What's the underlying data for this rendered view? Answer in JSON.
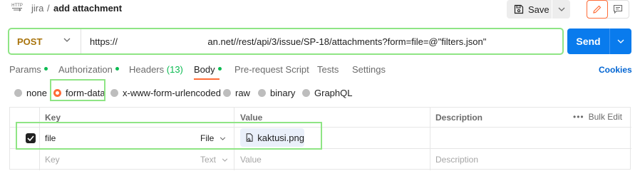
{
  "header": {
    "request_icon_text": "HTTP",
    "breadcrumb_parent": "jira",
    "breadcrumb_separator": "/",
    "breadcrumb_current": "add attachment",
    "save_label": "Save"
  },
  "request": {
    "method": "POST",
    "url": "https://                                   an.net//rest/api/3/issue/SP-18/attachments?form=file=@\"filters.json\"",
    "send_label": "Send"
  },
  "tabs": [
    {
      "label": "Params",
      "dot": true
    },
    {
      "label": "Authorization",
      "dot": true
    },
    {
      "label": "Headers",
      "count": "(13)"
    },
    {
      "label": "Body",
      "dot": true,
      "active": true
    },
    {
      "label": "Pre-request Script"
    },
    {
      "label": "Tests"
    },
    {
      "label": "Settings"
    }
  ],
  "cookies_label": "Cookies",
  "body_types": [
    "none",
    "form-data",
    "x-www-form-urlencoded",
    "raw",
    "binary",
    "GraphQL"
  ],
  "body_type_selected": "form-data",
  "table": {
    "headers": {
      "key": "Key",
      "value": "Value",
      "description": "Description",
      "bulk_edit": "Bulk Edit"
    },
    "rows": [
      {
        "checked": true,
        "key": "file",
        "type": "File",
        "value": "kaktusi.png",
        "description": ""
      }
    ],
    "placeholder": {
      "key": "Key",
      "type": "Text",
      "value": "Value",
      "description": "Description"
    }
  },
  "colors": {
    "accent": "#ff6c37",
    "send": "#097bed",
    "method": "#a8730c",
    "status_dot": "#0cbb52",
    "highlight": "#8fe585",
    "link": "#0265d2"
  }
}
